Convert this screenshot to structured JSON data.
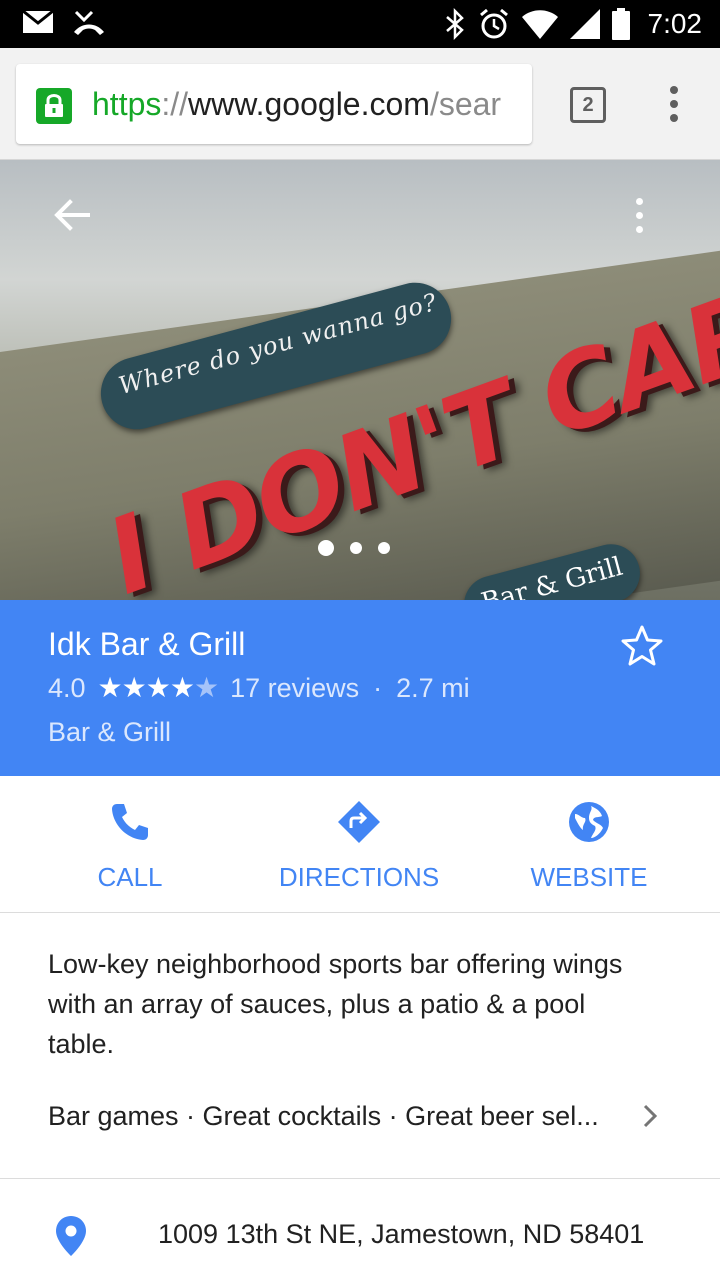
{
  "status_bar": {
    "time": "7:02",
    "icons": [
      "mail-icon",
      "missed-call-icon",
      "bluetooth-icon",
      "alarm-icon",
      "wifi-icon",
      "signal-icon",
      "battery-icon"
    ]
  },
  "browser": {
    "url_scheme": "https",
    "url_separator": "://",
    "url_host": "www.google.com",
    "url_path": "/sear",
    "tab_count": "2"
  },
  "hero": {
    "sign_top": "Where do you wanna go?",
    "sign_main": "I DON'T CARE",
    "sign_sub": "Bar & Grill",
    "photo_count": 3,
    "active_photo": 1
  },
  "place": {
    "name": "Idk Bar & Grill",
    "rating": "4.0",
    "rating_value": 4,
    "rating_max": 5,
    "reviews": "17 reviews",
    "separator": "·",
    "distance": "2.7 mi",
    "category": "Bar & Grill"
  },
  "actions": {
    "call": "CALL",
    "directions": "DIRECTIONS",
    "website": "WEBSITE"
  },
  "description": "Low-key neighborhood sports bar offering wings with an array of sauces, plus a patio & a pool table.",
  "features": "Bar games · Great cocktails · Great beer sel...",
  "address": "1009 13th St NE, Jamestown, ND 58401",
  "colors": {
    "accent": "#4285f4",
    "secure_green": "#16a828",
    "text": "#212121"
  }
}
